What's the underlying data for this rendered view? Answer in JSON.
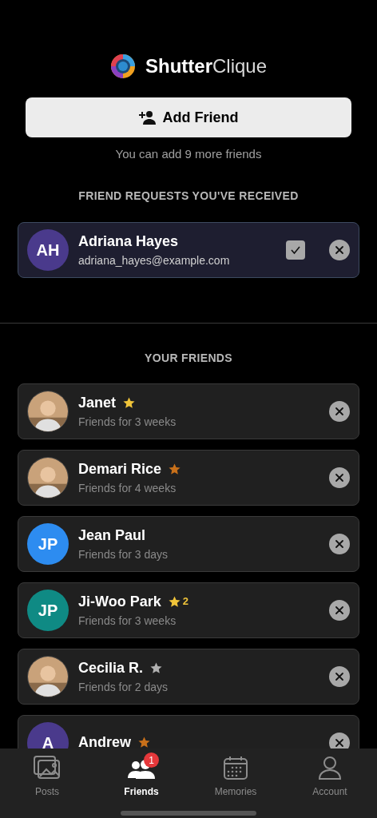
{
  "app": {
    "brand_bold": "Shutter",
    "brand_light": "Clique"
  },
  "add_friend": {
    "label": "Add Friend",
    "hint": "You can add 9 more friends"
  },
  "requests": {
    "heading": "FRIEND REQUESTS YOU'VE RECEIVED",
    "items": [
      {
        "avatar": {
          "initials": "AH",
          "color": "#4a3a8c"
        },
        "name": "Adriana Hayes",
        "email": "adriana_hayes@example.com"
      }
    ]
  },
  "friends": {
    "heading": "YOUR FRIENDS",
    "items": [
      {
        "name": "Janet",
        "star": {
          "color": "#f0c43a"
        },
        "subtitle": "Friends for 3 weeks"
      },
      {
        "name": "Demari Rice",
        "star": {
          "color": "#c8701a"
        },
        "subtitle": "Friends for 4 weeks"
      },
      {
        "avatar": {
          "kind": "initials",
          "initials": "JP",
          "color": "#2d8cf0"
        },
        "name": "Jean Paul",
        "subtitle": "Friends for 3 days"
      },
      {
        "avatar": {
          "kind": "initials",
          "initials": "JP",
          "color": "#0f8a84"
        },
        "name": "Ji-Woo Park",
        "star": {
          "color": "#f0c43a",
          "count": "2"
        },
        "subtitle": "Friends for 3 weeks"
      },
      {
        "name": "Cecilia R.",
        "star": {
          "color": "#b0b0b0"
        },
        "subtitle": "Friends for 2 days"
      },
      {
        "avatar": {
          "kind": "initials",
          "initials": "A",
          "color": "#4a3a8c"
        },
        "name": "Andrew",
        "star": {
          "color": "#c8701a"
        }
      }
    ]
  },
  "tabs": [
    {
      "kind": "posts",
      "label": "Posts",
      "selected": false
    },
    {
      "kind": "friends",
      "label": "Friends",
      "selected": true,
      "badge": "1"
    },
    {
      "kind": "memories",
      "label": "Memories",
      "selected": false
    },
    {
      "kind": "account",
      "label": "Account",
      "selected": false
    }
  ]
}
